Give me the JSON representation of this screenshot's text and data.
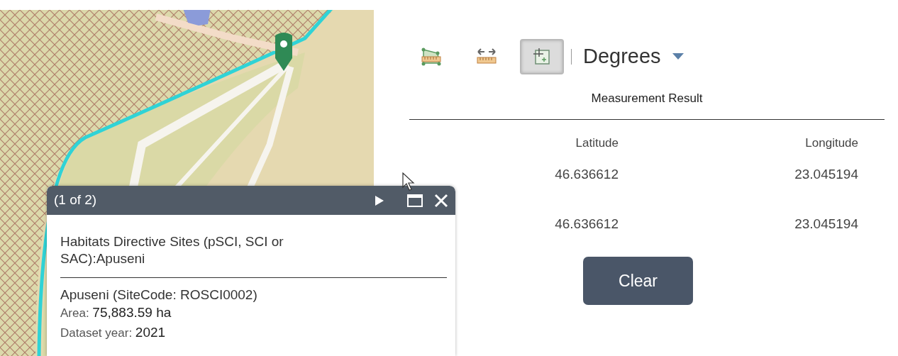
{
  "tools": [
    {
      "kind": "area",
      "selected": false
    },
    {
      "kind": "distance",
      "selected": false
    },
    {
      "kind": "location",
      "selected": true
    }
  ],
  "unit": {
    "label": "Degrees"
  },
  "result": {
    "title": "Measurement Result",
    "columns": [
      "Latitude",
      "Longitude"
    ],
    "rows": [
      [
        "46.636612",
        "23.045194"
      ],
      [
        "46.636612",
        "23.045194"
      ]
    ]
  },
  "clear_button": "Clear",
  "popup": {
    "counter": "(1 of 2)",
    "title": "Habitats Directive Sites (pSCI, SCI or SAC):Apuseni",
    "name": "Apuseni  (SiteCode: ROSCI0002)",
    "fields": [
      {
        "label": "Area:",
        "value": "75,883.59 ha"
      },
      {
        "label": "Dataset year:",
        "value": "2021"
      }
    ]
  }
}
